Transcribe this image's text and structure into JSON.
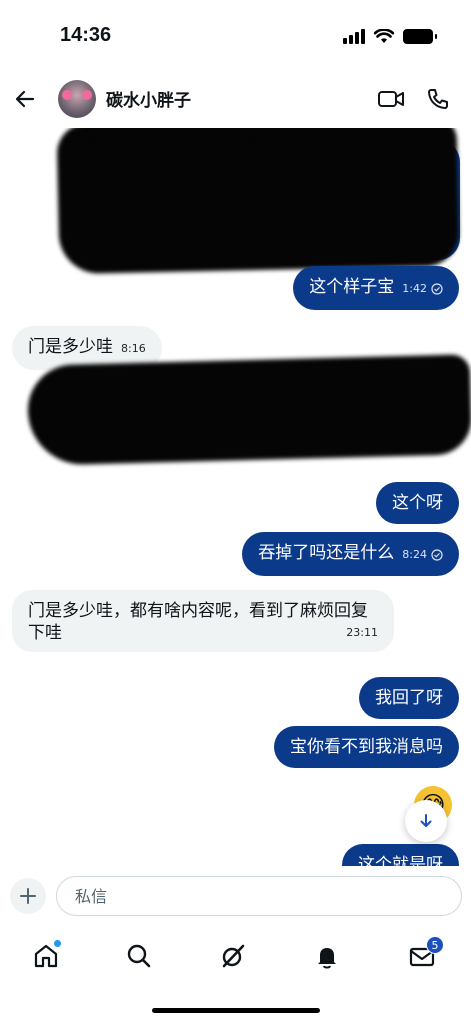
{
  "status_bar": {
    "time": "14:36"
  },
  "header": {
    "contact_name": "碳水小胖子"
  },
  "messages": [
    {
      "id": "m1",
      "text": "这个样子宝",
      "time": "1:42",
      "direction": "outgoing",
      "read": true
    },
    {
      "id": "m2",
      "text": "门是多少哇",
      "time": "8:16",
      "direction": "incoming"
    },
    {
      "id": "m3",
      "text": "这个呀",
      "time": "",
      "direction": "outgoing"
    },
    {
      "id": "m4",
      "text": "吞掉了吗还是什么",
      "time": "8:24",
      "direction": "outgoing",
      "read": true
    },
    {
      "id": "m5",
      "text_line1": "门是多少哇，都有啥内容呢，看到了麻烦回复",
      "text_line2": "下哇",
      "time": "23:11",
      "direction": "incoming"
    },
    {
      "id": "m6",
      "text": "我回了呀",
      "time": "",
      "direction": "outgoing"
    },
    {
      "id": "m7",
      "text": "宝你看不到我消息吗",
      "time": "",
      "direction": "outgoing"
    },
    {
      "id": "m8",
      "text": "这个就是呀",
      "time": "",
      "direction": "outgoing"
    }
  ],
  "emoji_reaction": "😅",
  "composer": {
    "placeholder": "私信"
  },
  "tabbar": {
    "messages_badge": "5"
  },
  "colors": {
    "outgoing_bubble": "#0b3a8b",
    "incoming_bubble": "#eff3f4",
    "accent": "#1d9bf0"
  },
  "icons": [
    "back-arrow-icon",
    "video-call-icon",
    "phone-call-icon",
    "scroll-down-icon",
    "plus-icon",
    "home-icon",
    "search-icon",
    "grok-icon",
    "bell-icon",
    "mail-icon"
  ]
}
